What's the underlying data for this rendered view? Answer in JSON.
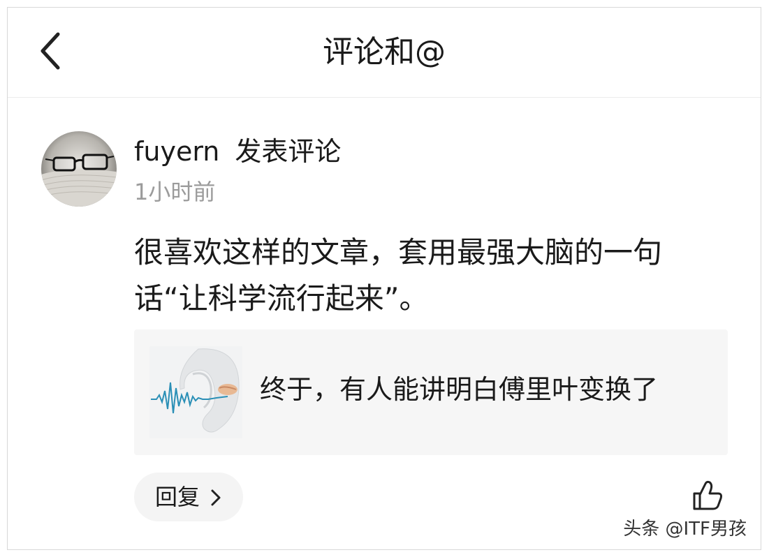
{
  "header": {
    "title": "评论和@",
    "back_icon": "chevron-left-icon"
  },
  "comment": {
    "avatar_icon": "glasses-on-book-avatar",
    "username": "fuyern",
    "action": "发表评论",
    "timestamp": "1小时前",
    "text": "很喜欢这样的文章，套用最强大脑的一句话“让科学流行起来”。"
  },
  "article": {
    "thumbnail_icon": "ear-soundwave-thumbnail",
    "title": "终于，有人能讲明白傅里叶变换了"
  },
  "actions": {
    "reply_label": "回复",
    "reply_icon": "chevron-right-icon",
    "like_icon": "thumbs-up-icon"
  },
  "watermark": "头条 @ITF男孩",
  "colors": {
    "text_primary": "#1a1a1a",
    "text_secondary": "#9b9b9b",
    "card_background": "#f6f6f6",
    "divider": "#ececec"
  }
}
